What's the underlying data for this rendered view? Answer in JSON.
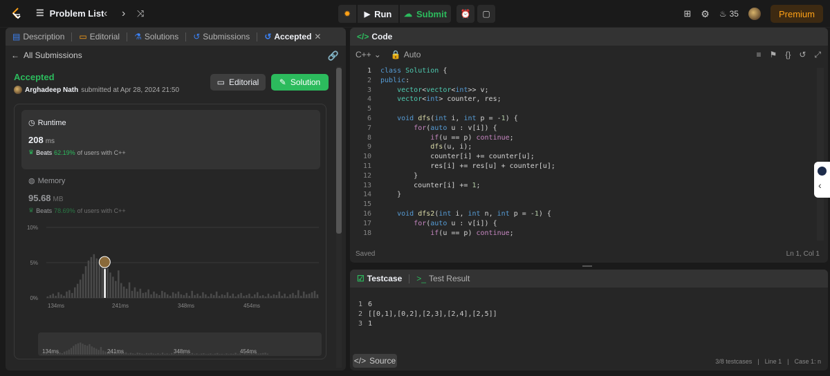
{
  "topbar": {
    "problem_list": "Problem List",
    "run": "Run",
    "submit": "Submit",
    "streak": "35",
    "premium": "Premium"
  },
  "left": {
    "tabs": [
      "Description",
      "Editorial",
      "Solutions",
      "Submissions",
      "Accepted"
    ],
    "all_submissions": "All Submissions",
    "status": "Accepted",
    "author": "Arghadeep Nath",
    "submitted_text": "submitted at Apr 28, 2024 21:50",
    "editorial_btn": "Editorial",
    "solution_btn": "Solution",
    "runtime": {
      "label": "Runtime",
      "value": "208",
      "unit": "ms",
      "beats_label": "Beats",
      "beats_pct": "62.19%",
      "beats_suffix": "of users with C++"
    },
    "memory": {
      "label": "Memory",
      "value": "95.68",
      "unit": "MB",
      "beats_label": "Beats",
      "beats_pct": "78.69%",
      "beats_suffix": "of users with C++"
    },
    "chart_y_ticks": [
      "10%",
      "5%",
      "0%"
    ],
    "chart_x_ticks": [
      "134ms",
      "241ms",
      "348ms",
      "454ms"
    ]
  },
  "chart_data": {
    "type": "bar",
    "xlabel": "",
    "ylabel": "",
    "ylim": [
      0,
      10
    ],
    "x_ticks": [
      "134ms",
      "241ms",
      "348ms",
      "454ms"
    ],
    "values": [
      0.2,
      0.4,
      0.6,
      0.3,
      0.8,
      0.5,
      0.3,
      0.9,
      1.1,
      0.7,
      1.5,
      2.0,
      2.6,
      3.4,
      4.5,
      5.3,
      5.8,
      6.2,
      5.6,
      5.0,
      4.6,
      5.4,
      4.2,
      3.6,
      3.0,
      2.4,
      3.9,
      2.1,
      1.6,
      1.3,
      2.2,
      1.0,
      1.5,
      0.9,
      1.3,
      0.7,
      0.8,
      1.2,
      0.5,
      0.9,
      0.6,
      0.4,
      1.0,
      0.8,
      0.5,
      0.3,
      0.8,
      0.6,
      0.9,
      0.5,
      0.4,
      0.7,
      0.3,
      1.0,
      0.4,
      0.6,
      0.3,
      0.8,
      0.5,
      0.2,
      0.6,
      0.4,
      0.9,
      0.3,
      0.5,
      0.4,
      0.8,
      0.3,
      0.6,
      0.2,
      0.5,
      0.7,
      0.3,
      0.4,
      0.6,
      0.2,
      0.5,
      0.8,
      0.3,
      0.4,
      0.2,
      0.6,
      0.3,
      0.5,
      0.4,
      0.9,
      0.3,
      0.6,
      0.2,
      0.5,
      0.7,
      0.4,
      1.1,
      0.3,
      0.9,
      0.5,
      0.6,
      0.8,
      1.0,
      0.5
    ],
    "highlight_index": 21,
    "highlight_value": 4.1
  },
  "code": {
    "title": "Code",
    "language": "C++",
    "mode": "Auto",
    "status": "Saved",
    "position": "Ln 1, Col 1",
    "lines": [
      {
        "n": "1",
        "html": "<span class='kw'>class</span> <span class='ty'>Solution</span> {"
      },
      {
        "n": "2",
        "html": "<span class='kw'>public</span>:"
      },
      {
        "n": "3",
        "html": "    <span class='ty'>vector</span>&lt;<span class='ty'>vector</span>&lt;<span class='kw'>int</span>&gt;&gt; v;"
      },
      {
        "n": "4",
        "html": "    <span class='ty'>vector</span>&lt;<span class='kw'>int</span>&gt; counter, res;"
      },
      {
        "n": "5",
        "html": ""
      },
      {
        "n": "6",
        "html": "    <span class='kw'>void</span> <span class='fn'>dfs</span>(<span class='kw'>int</span> i, <span class='kw'>int</span> p = -<span class='nm'>1</span>) {"
      },
      {
        "n": "7",
        "html": "        <span class='ctl'>for</span>(<span class='kw'>auto</span> u : v[i]) {"
      },
      {
        "n": "8",
        "html": "            <span class='ctl'>if</span>(u == p) <span class='ctl'>continue</span>;"
      },
      {
        "n": "9",
        "html": "            <span class='fn'>dfs</span>(u, i);"
      },
      {
        "n": "10",
        "html": "            counter[i] += counter[u];"
      },
      {
        "n": "11",
        "html": "            res[i] += res[u] + counter[u];"
      },
      {
        "n": "12",
        "html": "        }"
      },
      {
        "n": "13",
        "html": "        counter[i] += <span class='nm'>1</span>;"
      },
      {
        "n": "14",
        "html": "    }"
      },
      {
        "n": "15",
        "html": ""
      },
      {
        "n": "16",
        "html": "    <span class='kw'>void</span> <span class='fn'>dfs2</span>(<span class='kw'>int</span> i, <span class='kw'>int</span> n, <span class='kw'>int</span> p = -<span class='nm'>1</span>) {"
      },
      {
        "n": "17",
        "html": "        <span class='ctl'>for</span>(<span class='kw'>auto</span> u : v[i]) {"
      },
      {
        "n": "18",
        "html": "            <span class='ctl'>if</span>(u == p) <span class='ctl'>continue</span>;"
      }
    ]
  },
  "test": {
    "tab_testcase": "Testcase",
    "tab_result": "Test Result",
    "lines": [
      {
        "n": "1",
        "text": "6"
      },
      {
        "n": "2",
        "text": "[[0,1],[0,2],[2,3],[2,4],[2,5]]"
      },
      {
        "n": "3",
        "text": "1"
      }
    ],
    "source_btn": "Source",
    "testcases": "3/8 testcases",
    "line": "Line 1",
    "case": "Case 1: n"
  },
  "colors": {
    "accent_green": "#2cbb5d",
    "premium": "#ffa116",
    "bg": "#1a1a1a",
    "panel": "#262626"
  }
}
